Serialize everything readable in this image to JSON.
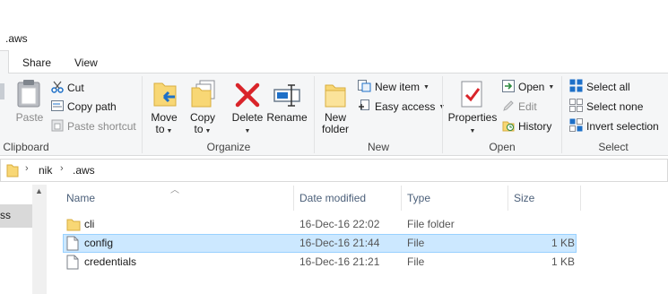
{
  "window": {
    "title": ".aws"
  },
  "tabs": [
    {
      "label": "Share"
    },
    {
      "label": "View"
    }
  ],
  "ribbon": {
    "clipboard": {
      "paste_label": "Paste",
      "cut_label": "Cut",
      "copy_path_label": "Copy path",
      "paste_shortcut_label": "Paste shortcut",
      "group_label": "Clipboard"
    },
    "organize": {
      "move_to_label_1": "Move",
      "move_to_label_2": "to",
      "copy_to_label_1": "Copy",
      "copy_to_label_2": "to",
      "delete_label": "Delete",
      "rename_label": "Rename",
      "group_label": "Organize"
    },
    "new": {
      "new_folder_label_1": "New",
      "new_folder_label_2": "folder",
      "new_item_label": "New item",
      "easy_access_label": "Easy access",
      "group_label": "New"
    },
    "open": {
      "properties_label": "Properties",
      "open_label": "Open",
      "edit_label": "Edit",
      "history_label": "History",
      "group_label": "Open"
    },
    "select": {
      "select_all_label": "Select all",
      "select_none_label": "Select none",
      "invert_selection_label": "Invert selection",
      "group_label": "Select"
    }
  },
  "address": {
    "crumbs": [
      "nik",
      ".aws"
    ]
  },
  "nav": {
    "selected_item_text": "ss"
  },
  "file_list": {
    "columns": {
      "name": "Name",
      "date_modified": "Date modified",
      "type": "Type",
      "size": "Size"
    },
    "rows": [
      {
        "name": "cli",
        "date": "16-Dec-16 22:02",
        "type": "File folder",
        "size": "",
        "icon": "folder-icon",
        "selected": false
      },
      {
        "name": "config",
        "date": "16-Dec-16 21:44",
        "type": "File",
        "size": "1 KB",
        "icon": "file-icon",
        "selected": true
      },
      {
        "name": "credentials",
        "date": "16-Dec-16 21:21",
        "type": "File",
        "size": "1 KB",
        "icon": "file-icon",
        "selected": false
      }
    ]
  },
  "colors": {
    "ribbon_bg": "#f5f6f7",
    "selection_bg": "#cce8ff",
    "selection_border": "#99d1ff",
    "folder_yellow": "#f8d775",
    "delete_red": "#d9242a",
    "accent_blue": "#1e70c8"
  }
}
